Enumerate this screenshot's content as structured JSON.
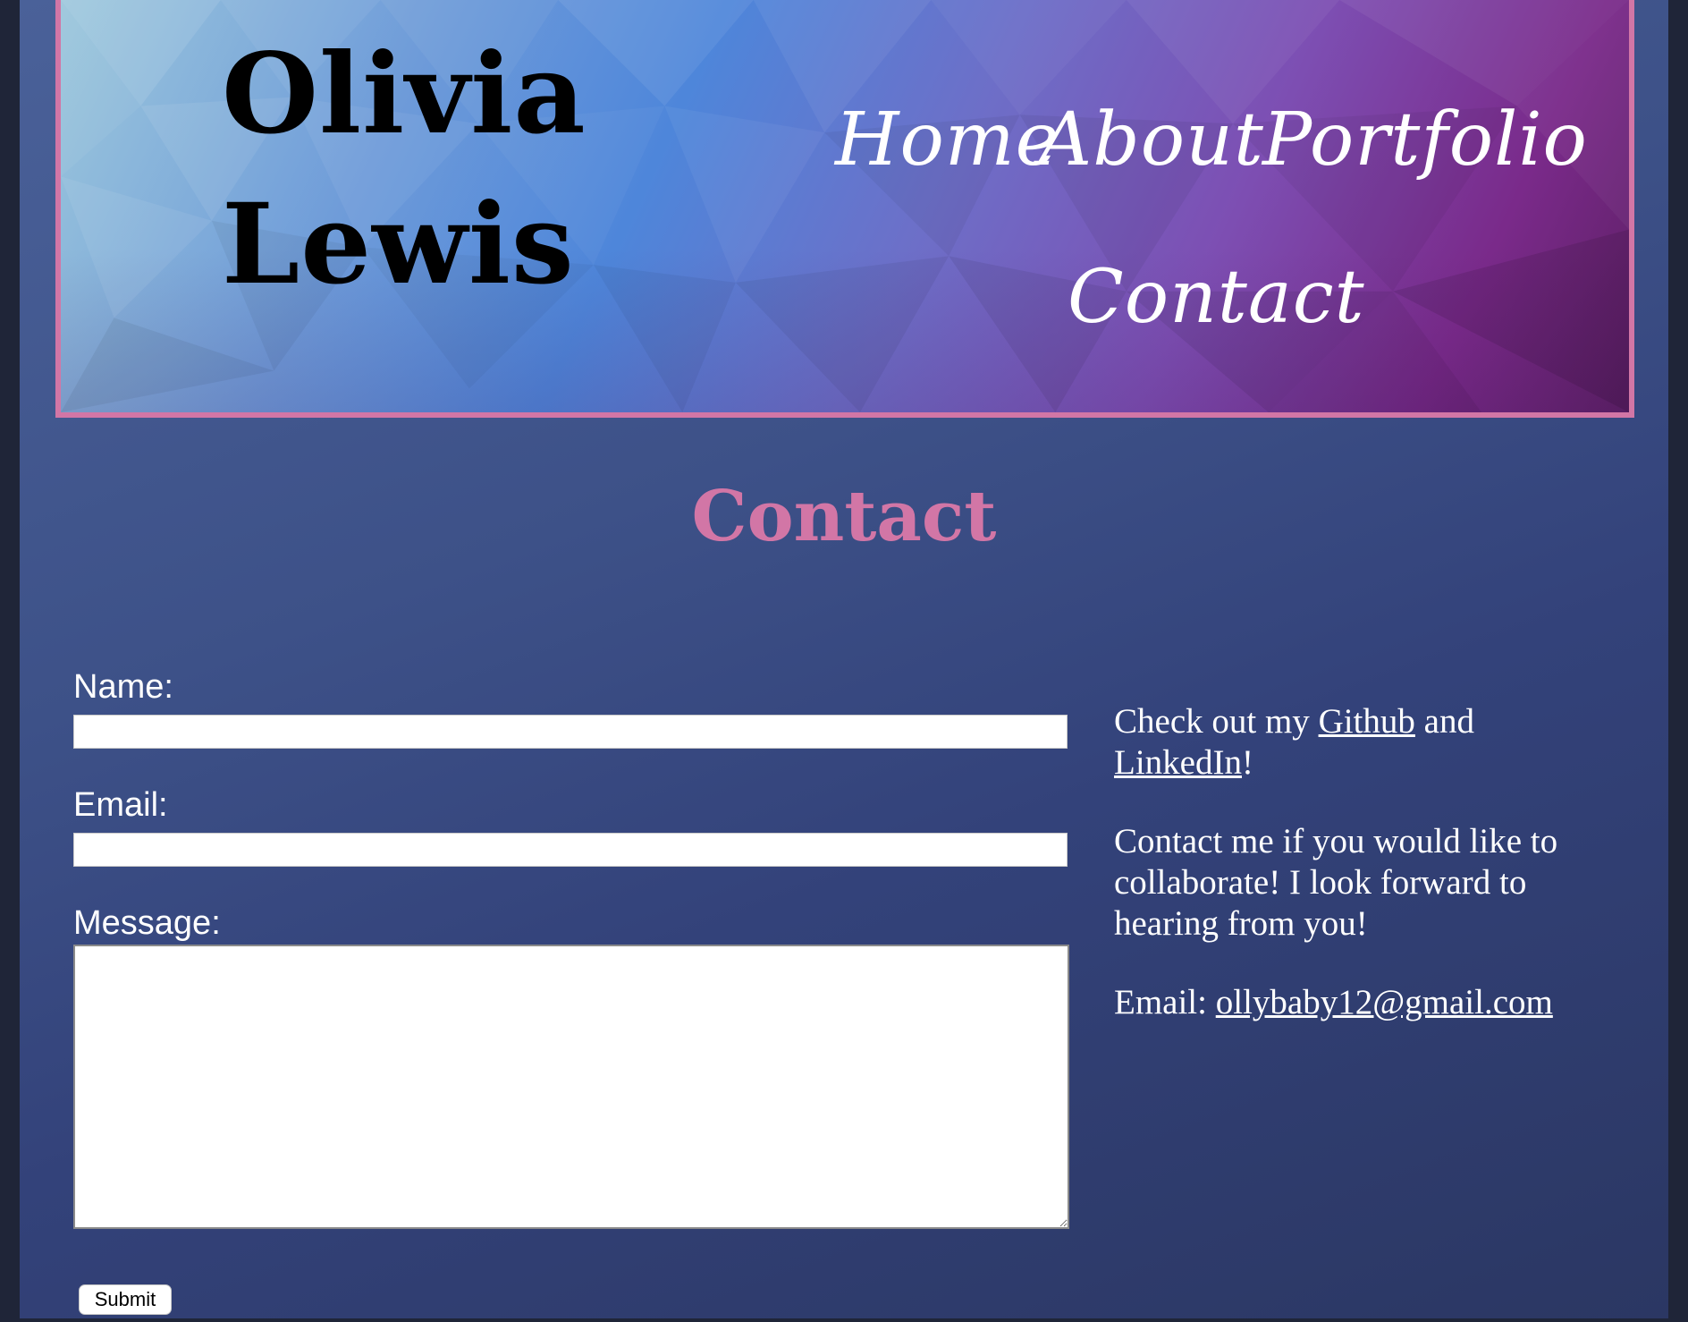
{
  "site": {
    "name_line1": "Olivia",
    "name_line2": "Lewis"
  },
  "nav": {
    "home": "Home",
    "about": "About",
    "portfolio": "Portfolio",
    "contact": "Contact"
  },
  "main": {
    "title": "Contact"
  },
  "form": {
    "name_label": "Name:",
    "name_value": "",
    "email_label": "Email:",
    "email_value": "",
    "message_label": "Message:",
    "message_value": "",
    "submit_label": "Submit"
  },
  "side": {
    "p1_prefix": "Check out my ",
    "github_link": "Github",
    "p1_middle": " and",
    "linkedin_link": "LinkedIn",
    "p1_suffix": "!",
    "p2": "Contact me if you would like to collaborate! I look forward to hearing from you!",
    "email_prefix": "Email: ",
    "email_link": "ollybaby12@gmail.com"
  },
  "colors": {
    "accent_pink": "#d276a6",
    "page_blue": "#3d5188",
    "header_border": "#d276a6"
  }
}
